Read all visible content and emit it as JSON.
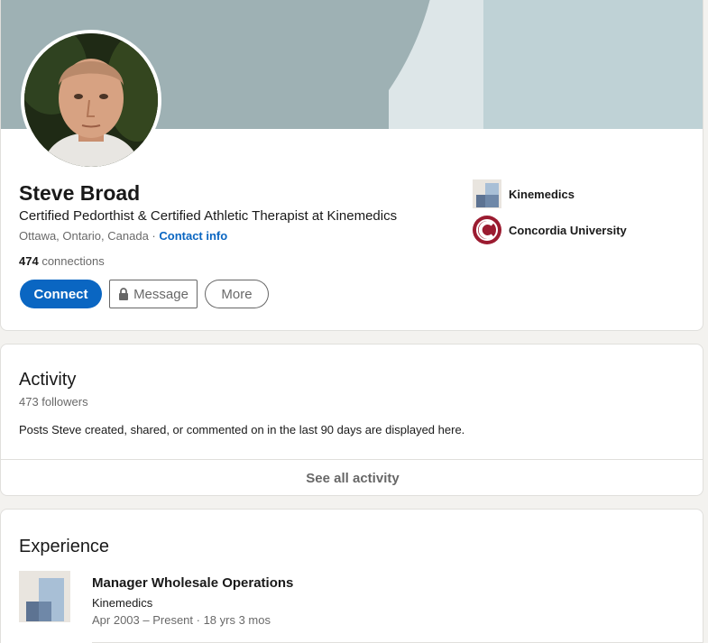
{
  "profile": {
    "name": "Steve Broad",
    "headline": "Certified Pedorthist & Certified Athletic Therapist at Kinemedics",
    "location": "Ottawa, Ontario, Canada",
    "separator": " · ",
    "contact_info": "Contact info",
    "connections_count": "474",
    "connections_label": " connections",
    "buttons": {
      "connect": "Connect",
      "message": "Message",
      "more": "More"
    },
    "organizations": [
      {
        "name": "Kinemedics",
        "icon": "kinemedics-logo"
      },
      {
        "name": "Concordia University",
        "icon": "concordia-logo"
      }
    ]
  },
  "activity": {
    "title": "Activity",
    "followers": "473 followers",
    "description": "Posts Steve created, shared, or commented on in the last 90 days are displayed here.",
    "see_all": "See all activity"
  },
  "experience": {
    "title": "Experience",
    "items": [
      {
        "role": "Manager Wholesale Operations",
        "company": "Kinemedics",
        "dates": "Apr 2003 – Present · 18 yrs 3 mos"
      }
    ]
  },
  "colors": {
    "primary": "#0a66c2",
    "background": "#f3f2ef",
    "cover": "#9eb1b4",
    "concordia": "#9b1b30"
  }
}
